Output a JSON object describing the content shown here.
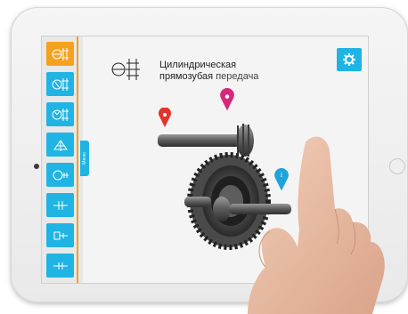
{
  "app": {
    "title_line1": "Цилиндрическая",
    "title_line2_bold": "прямозубая",
    "title_line2_thin": "передача",
    "menu_tab_label": "Меню"
  },
  "sidebar": {
    "items": [
      {
        "icon": "spur-gear-icon",
        "active": true
      },
      {
        "icon": "helical-gear-icon",
        "active": false
      },
      {
        "icon": "double-gear-icon",
        "active": false
      },
      {
        "icon": "bevel-gear-icon",
        "active": false
      },
      {
        "icon": "worm-gear-icon",
        "active": false
      },
      {
        "icon": "shaft-coupling-icon",
        "active": false
      },
      {
        "icon": "rack-gear-icon",
        "active": false
      },
      {
        "icon": "planetary-gear-icon",
        "active": false
      }
    ]
  },
  "markers": [
    {
      "label": "",
      "color": "#e2342a"
    },
    {
      "label": "",
      "color": "#d6277b"
    },
    {
      "label": "i",
      "color": "#1fa4d9"
    }
  ],
  "colors": {
    "accent_blue": "#1fb4e3",
    "accent_orange": "#f4a11d"
  }
}
